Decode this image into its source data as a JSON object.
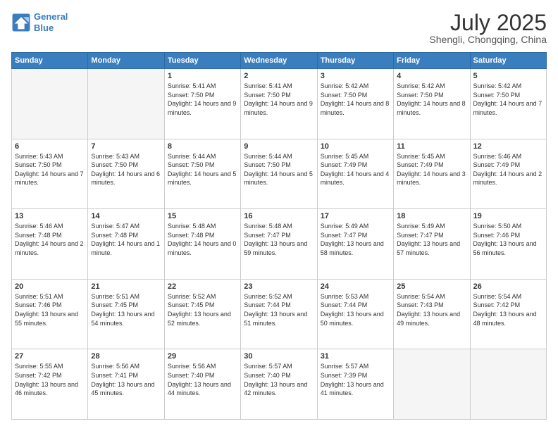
{
  "header": {
    "logo_line1": "General",
    "logo_line2": "Blue",
    "month_title": "July 2025",
    "location": "Shengli, Chongqing, China"
  },
  "weekdays": [
    "Sunday",
    "Monday",
    "Tuesday",
    "Wednesday",
    "Thursday",
    "Friday",
    "Saturday"
  ],
  "weeks": [
    [
      {
        "day": "",
        "info": ""
      },
      {
        "day": "",
        "info": ""
      },
      {
        "day": "1",
        "info": "Sunrise: 5:41 AM\nSunset: 7:50 PM\nDaylight: 14 hours and 9 minutes."
      },
      {
        "day": "2",
        "info": "Sunrise: 5:41 AM\nSunset: 7:50 PM\nDaylight: 14 hours and 9 minutes."
      },
      {
        "day": "3",
        "info": "Sunrise: 5:42 AM\nSunset: 7:50 PM\nDaylight: 14 hours and 8 minutes."
      },
      {
        "day": "4",
        "info": "Sunrise: 5:42 AM\nSunset: 7:50 PM\nDaylight: 14 hours and 8 minutes."
      },
      {
        "day": "5",
        "info": "Sunrise: 5:42 AM\nSunset: 7:50 PM\nDaylight: 14 hours and 7 minutes."
      }
    ],
    [
      {
        "day": "6",
        "info": "Sunrise: 5:43 AM\nSunset: 7:50 PM\nDaylight: 14 hours and 7 minutes."
      },
      {
        "day": "7",
        "info": "Sunrise: 5:43 AM\nSunset: 7:50 PM\nDaylight: 14 hours and 6 minutes."
      },
      {
        "day": "8",
        "info": "Sunrise: 5:44 AM\nSunset: 7:50 PM\nDaylight: 14 hours and 5 minutes."
      },
      {
        "day": "9",
        "info": "Sunrise: 5:44 AM\nSunset: 7:50 PM\nDaylight: 14 hours and 5 minutes."
      },
      {
        "day": "10",
        "info": "Sunrise: 5:45 AM\nSunset: 7:49 PM\nDaylight: 14 hours and 4 minutes."
      },
      {
        "day": "11",
        "info": "Sunrise: 5:45 AM\nSunset: 7:49 PM\nDaylight: 14 hours and 3 minutes."
      },
      {
        "day": "12",
        "info": "Sunrise: 5:46 AM\nSunset: 7:49 PM\nDaylight: 14 hours and 2 minutes."
      }
    ],
    [
      {
        "day": "13",
        "info": "Sunrise: 5:46 AM\nSunset: 7:48 PM\nDaylight: 14 hours and 2 minutes."
      },
      {
        "day": "14",
        "info": "Sunrise: 5:47 AM\nSunset: 7:48 PM\nDaylight: 14 hours and 1 minute."
      },
      {
        "day": "15",
        "info": "Sunrise: 5:48 AM\nSunset: 7:48 PM\nDaylight: 14 hours and 0 minutes."
      },
      {
        "day": "16",
        "info": "Sunrise: 5:48 AM\nSunset: 7:47 PM\nDaylight: 13 hours and 59 minutes."
      },
      {
        "day": "17",
        "info": "Sunrise: 5:49 AM\nSunset: 7:47 PM\nDaylight: 13 hours and 58 minutes."
      },
      {
        "day": "18",
        "info": "Sunrise: 5:49 AM\nSunset: 7:47 PM\nDaylight: 13 hours and 57 minutes."
      },
      {
        "day": "19",
        "info": "Sunrise: 5:50 AM\nSunset: 7:46 PM\nDaylight: 13 hours and 56 minutes."
      }
    ],
    [
      {
        "day": "20",
        "info": "Sunrise: 5:51 AM\nSunset: 7:46 PM\nDaylight: 13 hours and 55 minutes."
      },
      {
        "day": "21",
        "info": "Sunrise: 5:51 AM\nSunset: 7:45 PM\nDaylight: 13 hours and 54 minutes."
      },
      {
        "day": "22",
        "info": "Sunrise: 5:52 AM\nSunset: 7:45 PM\nDaylight: 13 hours and 52 minutes."
      },
      {
        "day": "23",
        "info": "Sunrise: 5:52 AM\nSunset: 7:44 PM\nDaylight: 13 hours and 51 minutes."
      },
      {
        "day": "24",
        "info": "Sunrise: 5:53 AM\nSunset: 7:44 PM\nDaylight: 13 hours and 50 minutes."
      },
      {
        "day": "25",
        "info": "Sunrise: 5:54 AM\nSunset: 7:43 PM\nDaylight: 13 hours and 49 minutes."
      },
      {
        "day": "26",
        "info": "Sunrise: 5:54 AM\nSunset: 7:42 PM\nDaylight: 13 hours and 48 minutes."
      }
    ],
    [
      {
        "day": "27",
        "info": "Sunrise: 5:55 AM\nSunset: 7:42 PM\nDaylight: 13 hours and 46 minutes."
      },
      {
        "day": "28",
        "info": "Sunrise: 5:56 AM\nSunset: 7:41 PM\nDaylight: 13 hours and 45 minutes."
      },
      {
        "day": "29",
        "info": "Sunrise: 5:56 AM\nSunset: 7:40 PM\nDaylight: 13 hours and 44 minutes."
      },
      {
        "day": "30",
        "info": "Sunrise: 5:57 AM\nSunset: 7:40 PM\nDaylight: 13 hours and 42 minutes."
      },
      {
        "day": "31",
        "info": "Sunrise: 5:57 AM\nSunset: 7:39 PM\nDaylight: 13 hours and 41 minutes."
      },
      {
        "day": "",
        "info": ""
      },
      {
        "day": "",
        "info": ""
      }
    ]
  ]
}
